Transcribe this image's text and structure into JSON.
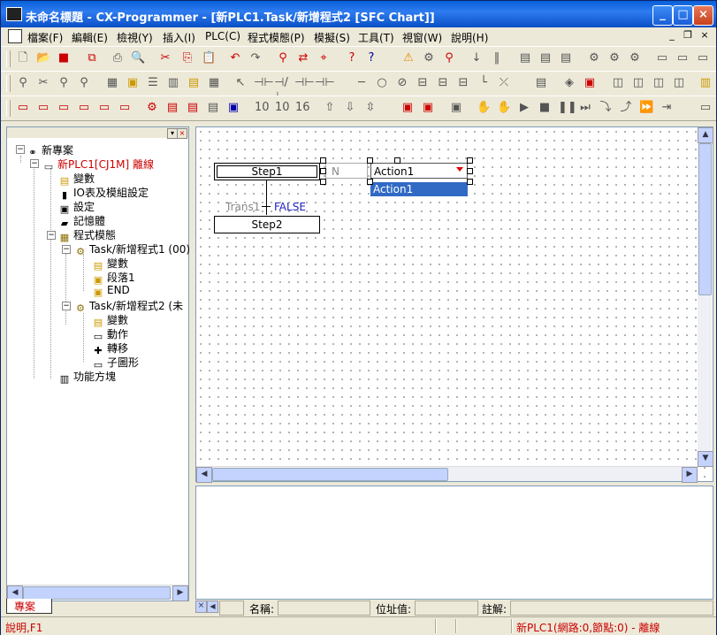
{
  "window": {
    "title": "未命名標題 - CX-Programmer - [新PLC1.Task/新增程式2 [SFC Chart]]",
    "minimize": "_",
    "maximize": "□",
    "close": "×"
  },
  "menu": {
    "items": [
      "檔案(F)",
      "編輯(E)",
      "檢視(Y)",
      "插入(I)",
      "PLC(C)",
      "程式模態(P)",
      "模擬(S)",
      "工具(T)",
      "視窗(W)",
      "說明(H)"
    ],
    "doc_minimize": "_",
    "doc_restore": "❐",
    "doc_close": "×"
  },
  "tree": {
    "root": "新專案",
    "plc": "新PLC1[CJ1M] 離線",
    "variables": "變數",
    "io_table": "IO表及模組設定",
    "settings": "設定",
    "memory": "記憶體",
    "programs": "程式模態",
    "task1": "Task/新增程式1 (00)",
    "task1_vars": "變數",
    "task1_section": "段落1",
    "task1_end": "END",
    "task2": "Task/新增程式2 (未",
    "task2_vars": "變數",
    "task2_actions": "動作",
    "task2_transitions": "轉移",
    "task2_subcharts": "子圖形",
    "function_blocks": "功能方塊"
  },
  "tabs": {
    "project": "專案"
  },
  "sfc": {
    "step1": "Step1",
    "step2": "Step2",
    "action_qualifier": "N",
    "action_name": "Action1",
    "dropdown_option": "Action1",
    "transition_name": "Trans1",
    "transition_value": "FALSE"
  },
  "infobar": {
    "name_label": "名稱:",
    "address_label": "位址值:",
    "comment_label": "註解:"
  },
  "status": {
    "help": "說明,F1",
    "plc_status": "新PLC1(網路:0,節點:0) - 離線"
  }
}
